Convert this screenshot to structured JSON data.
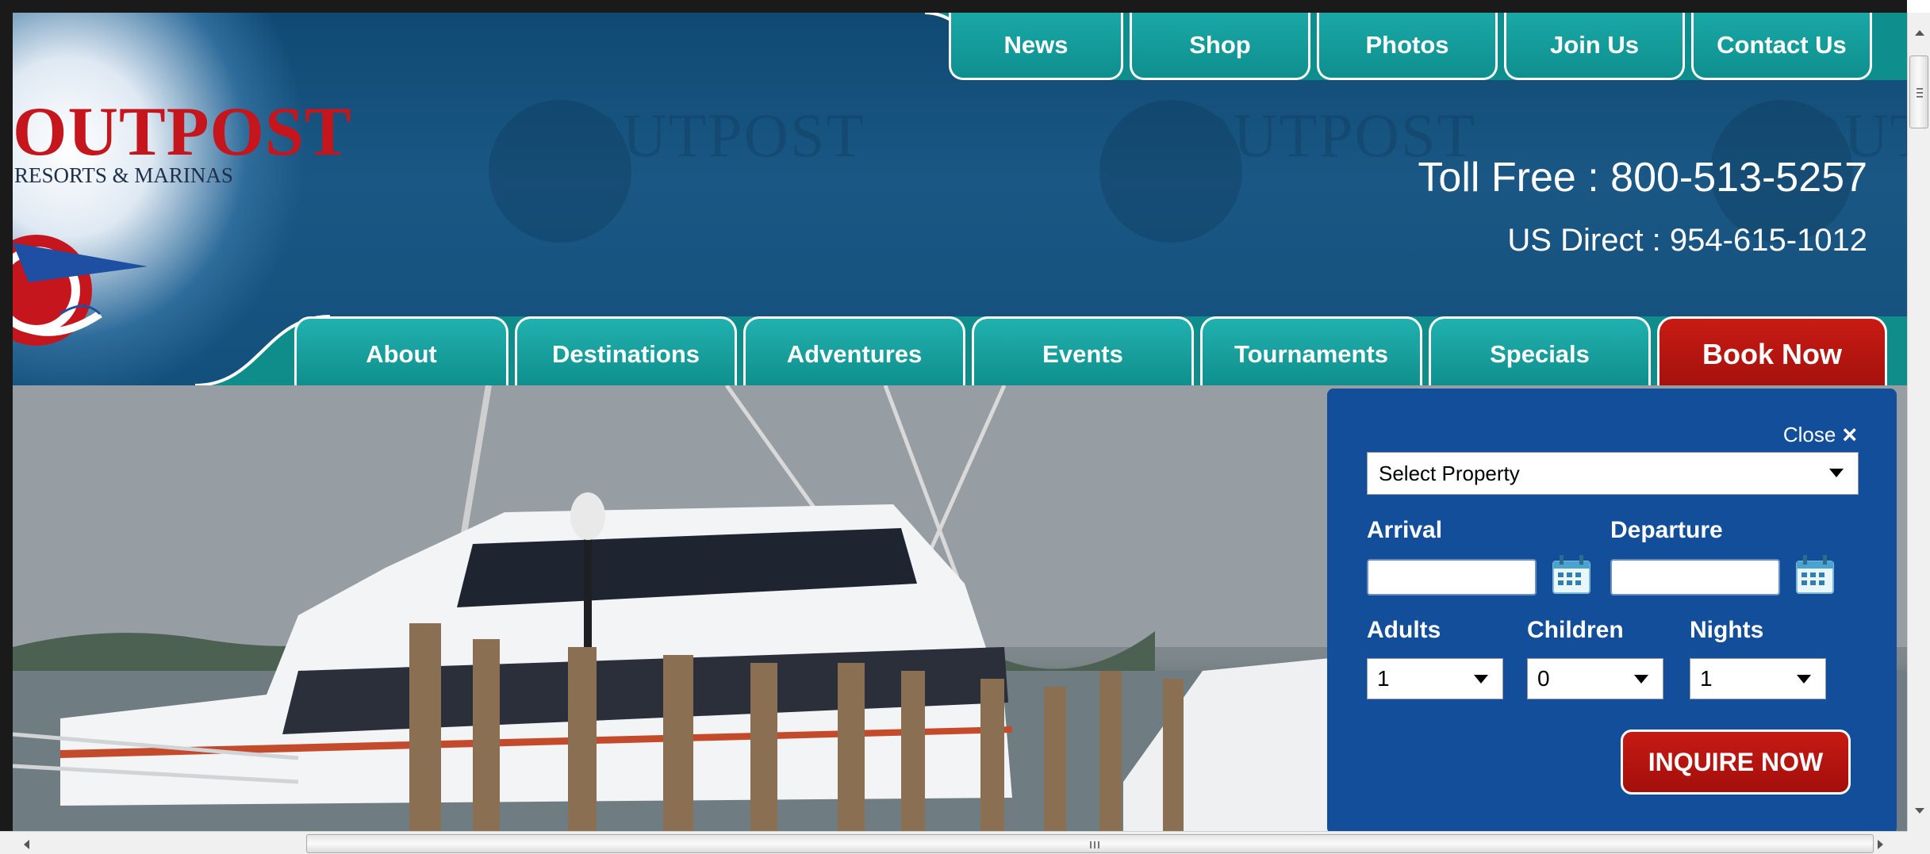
{
  "logo": {
    "title": "OUTPOST",
    "subtitle": "RESORTS & MARINAS"
  },
  "top_nav": [
    "News",
    "Shop",
    "Photos",
    "Join Us",
    "Contact Us"
  ],
  "contact": {
    "toll_free": "Toll Free : 800-513-5257",
    "us_direct": "US Direct : 954-615-1012"
  },
  "main_nav": [
    "About",
    "Destinations",
    "Adventures",
    "Events",
    "Tournaments",
    "Specials",
    "Book Now"
  ],
  "booking": {
    "close_label": "Close",
    "property_select": "Select Property",
    "arrival_label": "Arrival",
    "departure_label": "Departure",
    "adults_label": "Adults",
    "children_label": "Children",
    "nights_label": "Nights",
    "adults_value": "1",
    "children_value": "0",
    "nights_value": "1",
    "inquire_label": "INQUIRE NOW"
  },
  "colors": {
    "header_blue": "#1a5784",
    "teal_tab": "#1aa8a6",
    "brand_red": "#c4161c",
    "book_red": "#c81b14",
    "panel_blue": "#124e9a"
  }
}
